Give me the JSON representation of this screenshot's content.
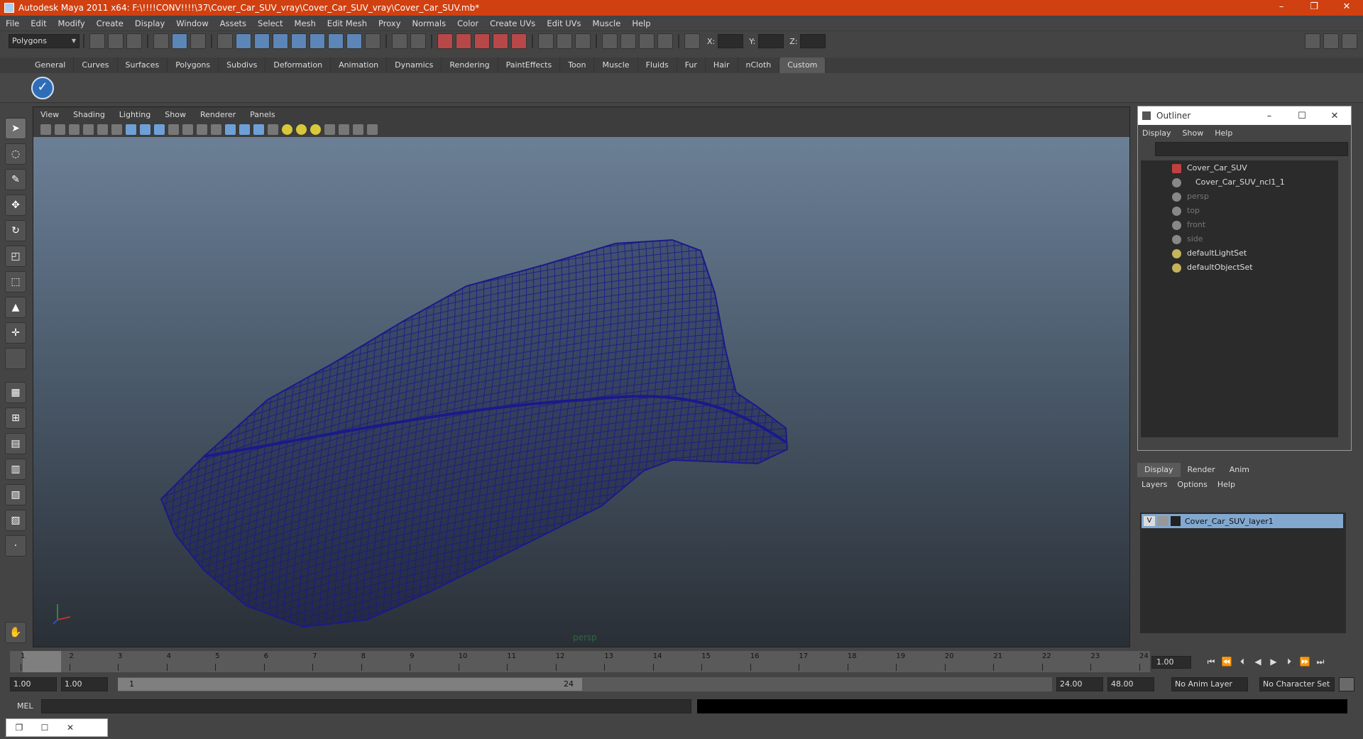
{
  "window": {
    "title": "Autodesk Maya 2011 x64: F:\\!!!!CONV!!!!\\37\\Cover_Car_SUV_vray\\Cover_Car_SUV_vray\\Cover_Car_SUV.mb*",
    "controls": [
      "–",
      "❐",
      "✕"
    ]
  },
  "menubar": [
    "File",
    "Edit",
    "Modify",
    "Create",
    "Display",
    "Window",
    "Assets",
    "Select",
    "Mesh",
    "Edit Mesh",
    "Proxy",
    "Normals",
    "Color",
    "Create UVs",
    "Edit UVs",
    "Muscle",
    "Help"
  ],
  "statusline": {
    "mode": "Polygons",
    "x_label": "X:",
    "y_label": "Y:",
    "z_label": "Z:"
  },
  "shelf": {
    "tabs": [
      "General",
      "Curves",
      "Surfaces",
      "Polygons",
      "Subdivs",
      "Deformation",
      "Animation",
      "Dynamics",
      "Rendering",
      "PaintEffects",
      "Toon",
      "Muscle",
      "Fluids",
      "Fur",
      "Hair",
      "nCloth",
      "Custom"
    ],
    "active_tab": "Custom",
    "icon": "checkmark-icon"
  },
  "viewport": {
    "menu": [
      "View",
      "Shading",
      "Lighting",
      "Show",
      "Renderer",
      "Panels"
    ],
    "camera_label": "persp",
    "wire_color": "#1a1a8a"
  },
  "outliner": {
    "title": "Outliner",
    "controls": [
      "–",
      "☐",
      "✕"
    ],
    "menu": [
      "Display",
      "Show",
      "Help"
    ],
    "items": [
      {
        "label": "Cover_Car_SUV",
        "icon": "transform-icon",
        "dim": false
      },
      {
        "label": "Cover_Car_SUV_ncl1_1",
        "icon": "ncloth-icon",
        "dim": false
      },
      {
        "label": "persp",
        "icon": "camera-icon",
        "dim": true
      },
      {
        "label": "top",
        "icon": "camera-icon",
        "dim": true
      },
      {
        "label": "front",
        "icon": "camera-icon",
        "dim": true
      },
      {
        "label": "side",
        "icon": "camera-icon",
        "dim": true
      },
      {
        "label": "defaultLightSet",
        "icon": "set-icon",
        "dim": false
      },
      {
        "label": "defaultObjectSet",
        "icon": "set-icon",
        "dim": false
      }
    ]
  },
  "layers": {
    "tabs": [
      "Display",
      "Render",
      "Anim"
    ],
    "active_tab": "Display",
    "menu": [
      "Layers",
      "Options",
      "Help"
    ],
    "layer_name": "Cover_Car_SUV_layer1",
    "visibility": "V"
  },
  "timeslider": {
    "ticks": [
      "1",
      "2",
      "3",
      "4",
      "5",
      "6",
      "7",
      "8",
      "9",
      "10",
      "11",
      "12",
      "13",
      "14",
      "15",
      "16",
      "17",
      "18",
      "19",
      "20",
      "21",
      "22",
      "23",
      "24"
    ],
    "current_marker": "1",
    "current_frame": "1.00"
  },
  "rangeslider": {
    "start": "1.00",
    "anim_start": "1.00",
    "range_start": "1",
    "range_end": "24",
    "anim_end": "24.00",
    "end": "48.00",
    "anim_layer": "No Anim Layer",
    "character_set": "No Character Set"
  },
  "commandline": {
    "label": "MEL"
  },
  "helpline": {
    "controls": [
      "❐",
      "☐",
      "✕"
    ]
  }
}
